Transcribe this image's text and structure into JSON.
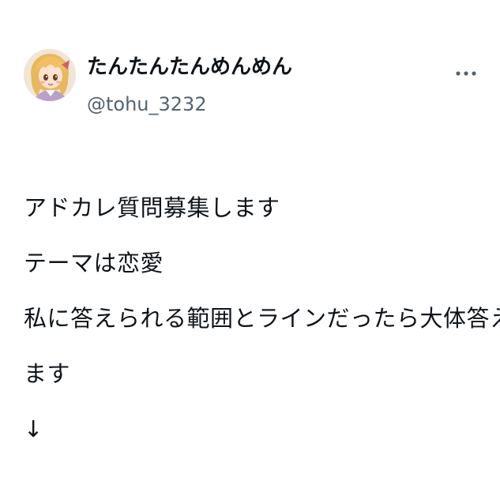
{
  "post": {
    "author": {
      "display_name": "たんたんたんめんめん",
      "handle": "@tohu_3232",
      "avatar_icon": "avatar-anime-character"
    },
    "more_icon": "more-horizontal-icon",
    "body_lines": [
      "アドカレ質問募集します",
      "テーマは恋愛",
      "私に答えられる範囲とラインだったら大体答え",
      "ます",
      "↓"
    ]
  },
  "colors": {
    "text": "#0f1419",
    "secondary_text": "#536471",
    "background": "#ffffff"
  }
}
